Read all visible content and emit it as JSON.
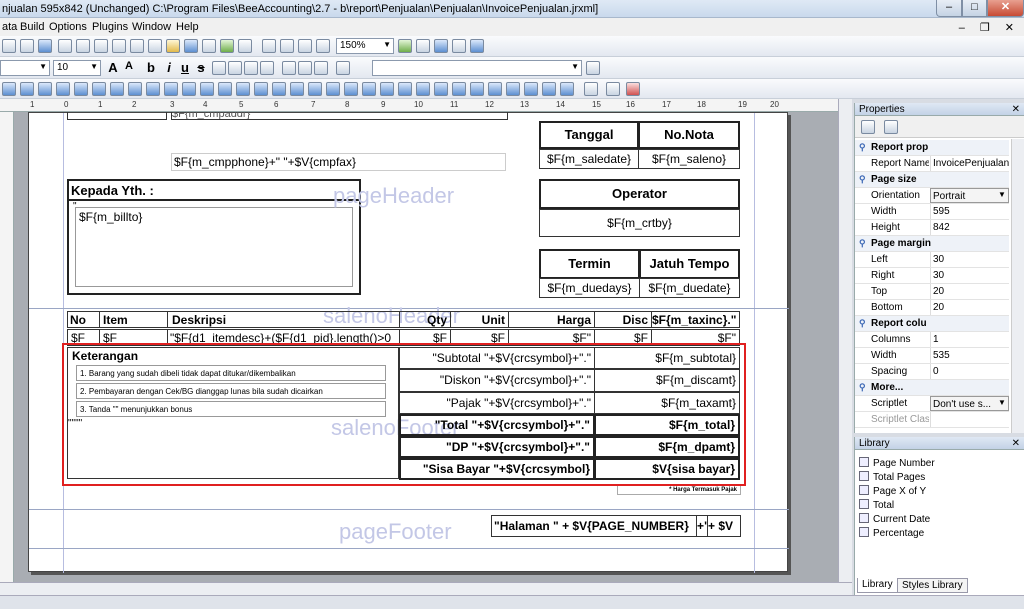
{
  "window": {
    "title": "njualan 595x842 (Unchanged) C:\\Program Files\\BeeAccounting\\2.7 - b\\report\\Penjualan\\Penjualan\\InvoicePenjualan.jrxml]",
    "minimize": "–",
    "maximize": "□",
    "close": "✕"
  },
  "menu": {
    "items": [
      "ata",
      "Build",
      "Options",
      "Plugins",
      "Window",
      "Help"
    ],
    "mdi_controls": "– ❐ ✕"
  },
  "toolbar": {
    "zoom": "150%",
    "font_size": "10",
    "font_buttons": [
      "A",
      "A",
      "b",
      "i",
      "u",
      "s"
    ]
  },
  "ruler": {
    "ticks": [
      "1",
      "0",
      "1",
      "2",
      "3",
      "4",
      "5",
      "6",
      "7",
      "8",
      "9",
      "10",
      "11",
      "12",
      "13",
      "14",
      "15",
      "16",
      "17",
      "18",
      "19",
      "20"
    ]
  },
  "report": {
    "fields": {
      "cmpaddr": "$F{m_cmpaddr}",
      "cmpphone": "$F{m_cmpphone}+\" \"+$V{cmpfax}",
      "tanggal_label": "Tanggal",
      "nonota_label": "No.Nota",
      "saledate": "$F{m_saledate}",
      "saleno": "$F{m_saleno}",
      "kepada": "Kepada Yth.  :",
      "quote": "\"",
      "billto": "$F{m_billto}",
      "operator_label": "Operator",
      "crtby": "$F{m_crtby}",
      "termin_label": "Termin",
      "jatuh_label": "Jatuh Tempo",
      "duedays": "$F{m_duedays}",
      "duedate": "$F{m_duedate}",
      "col_no": "No",
      "col_item": "Item",
      "col_desc": "Deskripsi",
      "col_qty": "Qty",
      "col_unit": "Unit",
      "col_harga": "Harga",
      "col_disc": "Disc",
      "col_taxinc": "$F{m_taxinc}.\"",
      "row_no": "$F",
      "row_item": "$F",
      "row_desc": "\"$F{d1_itemdesc}+($F{d1_pid}.length()>0",
      "row_qty": "$F",
      "row_unit": "$F",
      "row_harga": "$F\"",
      "row_disc": "$F",
      "row_total": "$F\"",
      "keterangan": "Keterangan",
      "note1": "1. Barang yang sudah dibeli tidak dapat ditukar/dikembalikan",
      "note2": "2. Pembayaran dengan Cek/BG dianggap lunas bila sudah dicairkan",
      "note3": "3. Tanda \"\" menunjukkan bonus",
      "quotes": "\"\"\"\"",
      "subtotal_label": "\"Subtotal \"+$V{crcsymbol}+\".\"",
      "subtotal": "$F{m_subtotal}",
      "diskon_label": "\"Diskon \"+$V{crcsymbol}+\".\"",
      "discamt": "$F{m_discamt}",
      "pajak_label": "\"Pajak \"+$V{crcsymbol}+\".\"",
      "taxamt": "$F{m_taxamt}",
      "total_label": "\"Total \"+$V{crcsymbol}+\".\"",
      "total": "$F{m_total}",
      "dp_label": "\"DP \"+$V{crcsymbol}+\".\"",
      "dpamt": "$F{m_dpamt}",
      "sisa_label": "\"Sisa Bayar \"+$V{crcsymbol}",
      "sisa": "$V{sisa bayar}",
      "harga_note": "* Harga Termasuk Pajak",
      "halaman": "\"Halaman \" + $V{PAGE_NUMBER}",
      "halaman2": "+\"",
      "halaman3": "+ $V"
    },
    "bands": {
      "pageHeader": "pageHeader",
      "salenoHeader": "salenoHeader",
      "salenoFooter": "salenoFooter",
      "pageFooter": "pageFooter"
    }
  },
  "properties": {
    "title": "Properties",
    "close": "✕",
    "rows": [
      {
        "cat": true,
        "name": "Report prop",
        "value": ""
      },
      {
        "cat": false,
        "name": "Report Name",
        "value": "InvoicePenjualan"
      },
      {
        "cat": true,
        "name": "Page size",
        "value": ""
      },
      {
        "cat": false,
        "name": "Orientation",
        "value": "Portrait"
      },
      {
        "cat": false,
        "name": "Width",
        "value": "595"
      },
      {
        "cat": false,
        "name": "Height",
        "value": "842"
      },
      {
        "cat": true,
        "name": "Page margin",
        "value": ""
      },
      {
        "cat": false,
        "name": "Left",
        "value": "30"
      },
      {
        "cat": false,
        "name": "Right",
        "value": "30"
      },
      {
        "cat": false,
        "name": "Top",
        "value": "20"
      },
      {
        "cat": false,
        "name": "Bottom",
        "value": "20"
      },
      {
        "cat": true,
        "name": "Report colu",
        "value": ""
      },
      {
        "cat": false,
        "name": "Columns",
        "value": "1"
      },
      {
        "cat": false,
        "name": "Width",
        "value": "535"
      },
      {
        "cat": false,
        "name": "Spacing",
        "value": "0"
      },
      {
        "cat": true,
        "name": "More...",
        "value": ""
      },
      {
        "cat": false,
        "name": "Scriptlet",
        "value": "Don't use s..."
      },
      {
        "cat": false,
        "name": "Scriptlet Class",
        "value": "",
        "disabled": true
      }
    ]
  },
  "library": {
    "title": "Library",
    "close": "✕",
    "items": [
      "Page Number",
      "Total Pages",
      "Page X of Y",
      "Total",
      "Current Date",
      "Percentage"
    ],
    "tabs": [
      "Library",
      "Styles Library"
    ]
  }
}
